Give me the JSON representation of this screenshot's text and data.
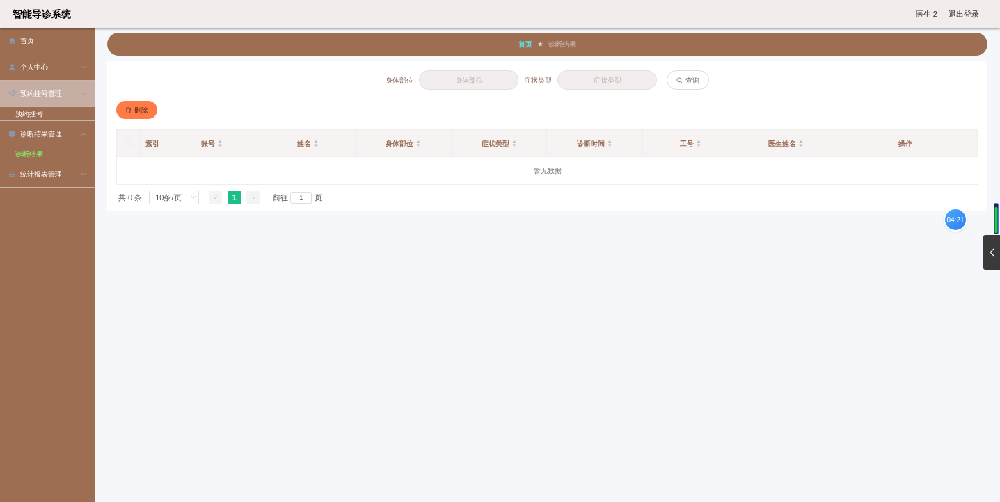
{
  "header": {
    "title": "智能导诊系统",
    "user": "医生 2",
    "logout": "退出登录"
  },
  "sidebar": {
    "items": [
      {
        "label": "首页",
        "selected": false
      },
      {
        "label": "个人中心",
        "selected": false,
        "expanded": false
      },
      {
        "label": "预约挂号管理",
        "selected": true,
        "expanded": true,
        "children": [
          {
            "label": "预约挂号",
            "selected": false
          }
        ]
      },
      {
        "label": "诊断结果管理",
        "selected": false,
        "expanded": true,
        "children": [
          {
            "label": "诊断结果",
            "selected": true
          }
        ]
      },
      {
        "label": "统计报表管理",
        "selected": false,
        "expanded": false
      }
    ]
  },
  "breadcrumb": [
    {
      "label": "首页"
    },
    {
      "label": "诊断结果"
    }
  ],
  "search": {
    "fields": [
      {
        "label": "身体部位",
        "placeholder": "身体部位"
      },
      {
        "label": "症状类型",
        "placeholder": "症状类型"
      }
    ],
    "button": "查询"
  },
  "toolbar": {
    "delete": "删除"
  },
  "table": {
    "select_all": false,
    "columns": [
      {
        "label": "索引",
        "sortable": false
      },
      {
        "label": "账号",
        "sortable": true
      },
      {
        "label": "姓名",
        "sortable": true
      },
      {
        "label": "身体部位",
        "sortable": true
      },
      {
        "label": "症状类型",
        "sortable": true
      },
      {
        "label": "诊断时间",
        "sortable": true
      },
      {
        "label": "工号",
        "sortable": true
      },
      {
        "label": "医生姓名",
        "sortable": true
      },
      {
        "label": "操作",
        "sortable": false
      }
    ],
    "empty_text": "暂无数据"
  },
  "pagination": {
    "total": "共 0 条",
    "page_size": "10条/页",
    "pages": [
      {
        "label": "1",
        "selected": true
      }
    ],
    "goto_label": "前往",
    "goto_value": "1",
    "goto_suffix": "页"
  },
  "timer": "04:21"
}
